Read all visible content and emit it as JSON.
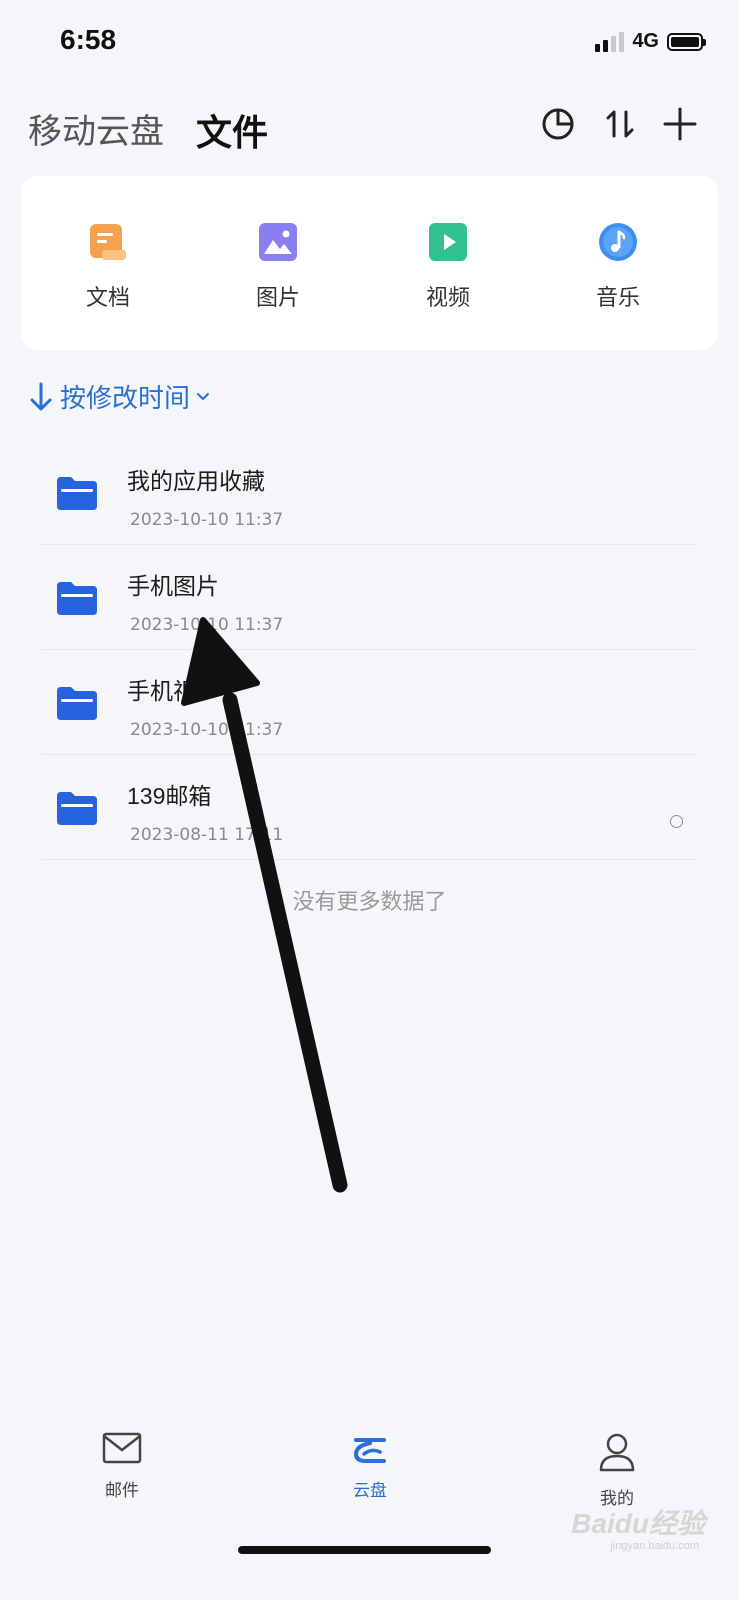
{
  "status": {
    "time": "6:58",
    "network": "4G"
  },
  "header": {
    "tab_inactive": "移动云盘",
    "tab_active": "文件"
  },
  "categories": [
    {
      "label": "文档",
      "icon": "document-icon",
      "color": "#f6a14f"
    },
    {
      "label": "图片",
      "icon": "image-icon",
      "color": "#8a7ff0"
    },
    {
      "label": "视频",
      "icon": "video-icon",
      "color": "#33c28f"
    },
    {
      "label": "音乐",
      "icon": "music-icon",
      "color": "#3d8ef0"
    }
  ],
  "sort": {
    "label": "按修改时间"
  },
  "files": [
    {
      "name": "我的应用收藏",
      "date": "2023-10-10 11:37"
    },
    {
      "name": "手机图片",
      "date": "2023-10-10 11:37"
    },
    {
      "name": "手机视",
      "date": "2023-10-10 11:37"
    },
    {
      "name": "139邮箱",
      "date": "2023-08-11 17:11"
    }
  ],
  "list_end": "没有更多数据了",
  "nav": {
    "mail": "邮件",
    "cloud": "云盘",
    "me": "我的"
  },
  "watermark": {
    "text": "Baidu经验",
    "sub": "jingyan.baidu.com"
  },
  "colors": {
    "accent": "#2b6fd9",
    "folder": "#2563e0"
  }
}
